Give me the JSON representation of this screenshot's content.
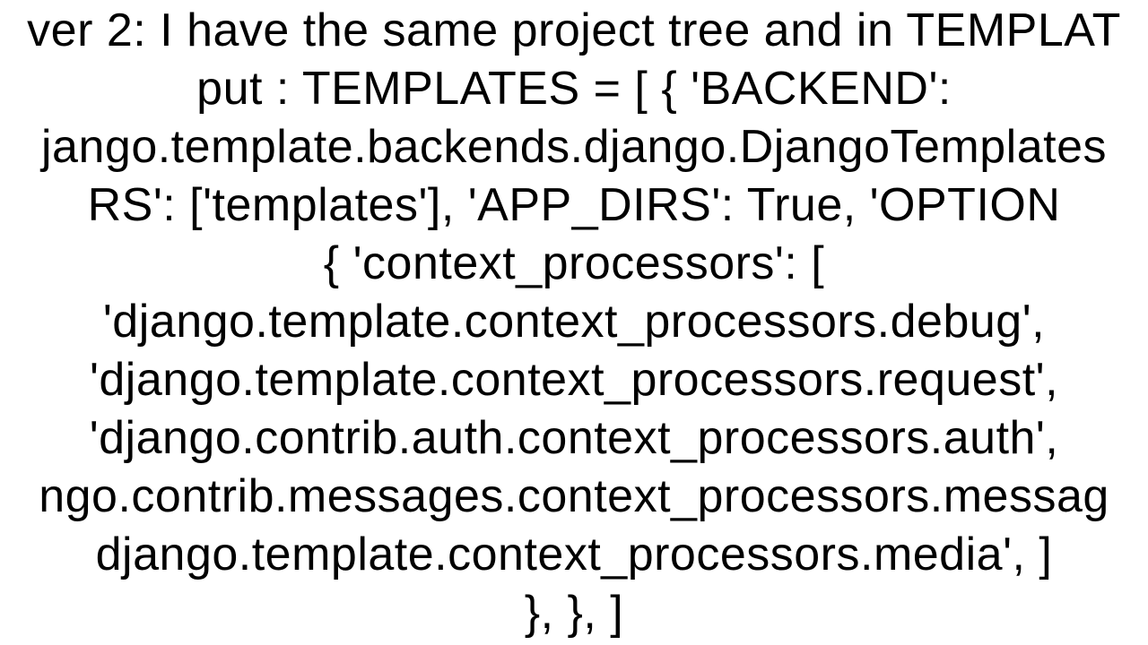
{
  "lines": [
    "ver 2: I have the same project tree and in TEMPLAT",
    "put : TEMPLATES = [ {     'BACKEND':",
    "jango.template.backends.django.DjangoTemplates",
    "RS': ['templates'],     'APP_DIRS': True,     'OPTION",
    "{         'context_processors': [",
    "'django.template.context_processors.debug',",
    "'django.template.context_processors.request',",
    "'django.contrib.auth.context_processors.auth',",
    "ngo.contrib.messages.context_processors.messag",
    "django.template.context_processors.media',         ]",
    "}, },  ]"
  ]
}
